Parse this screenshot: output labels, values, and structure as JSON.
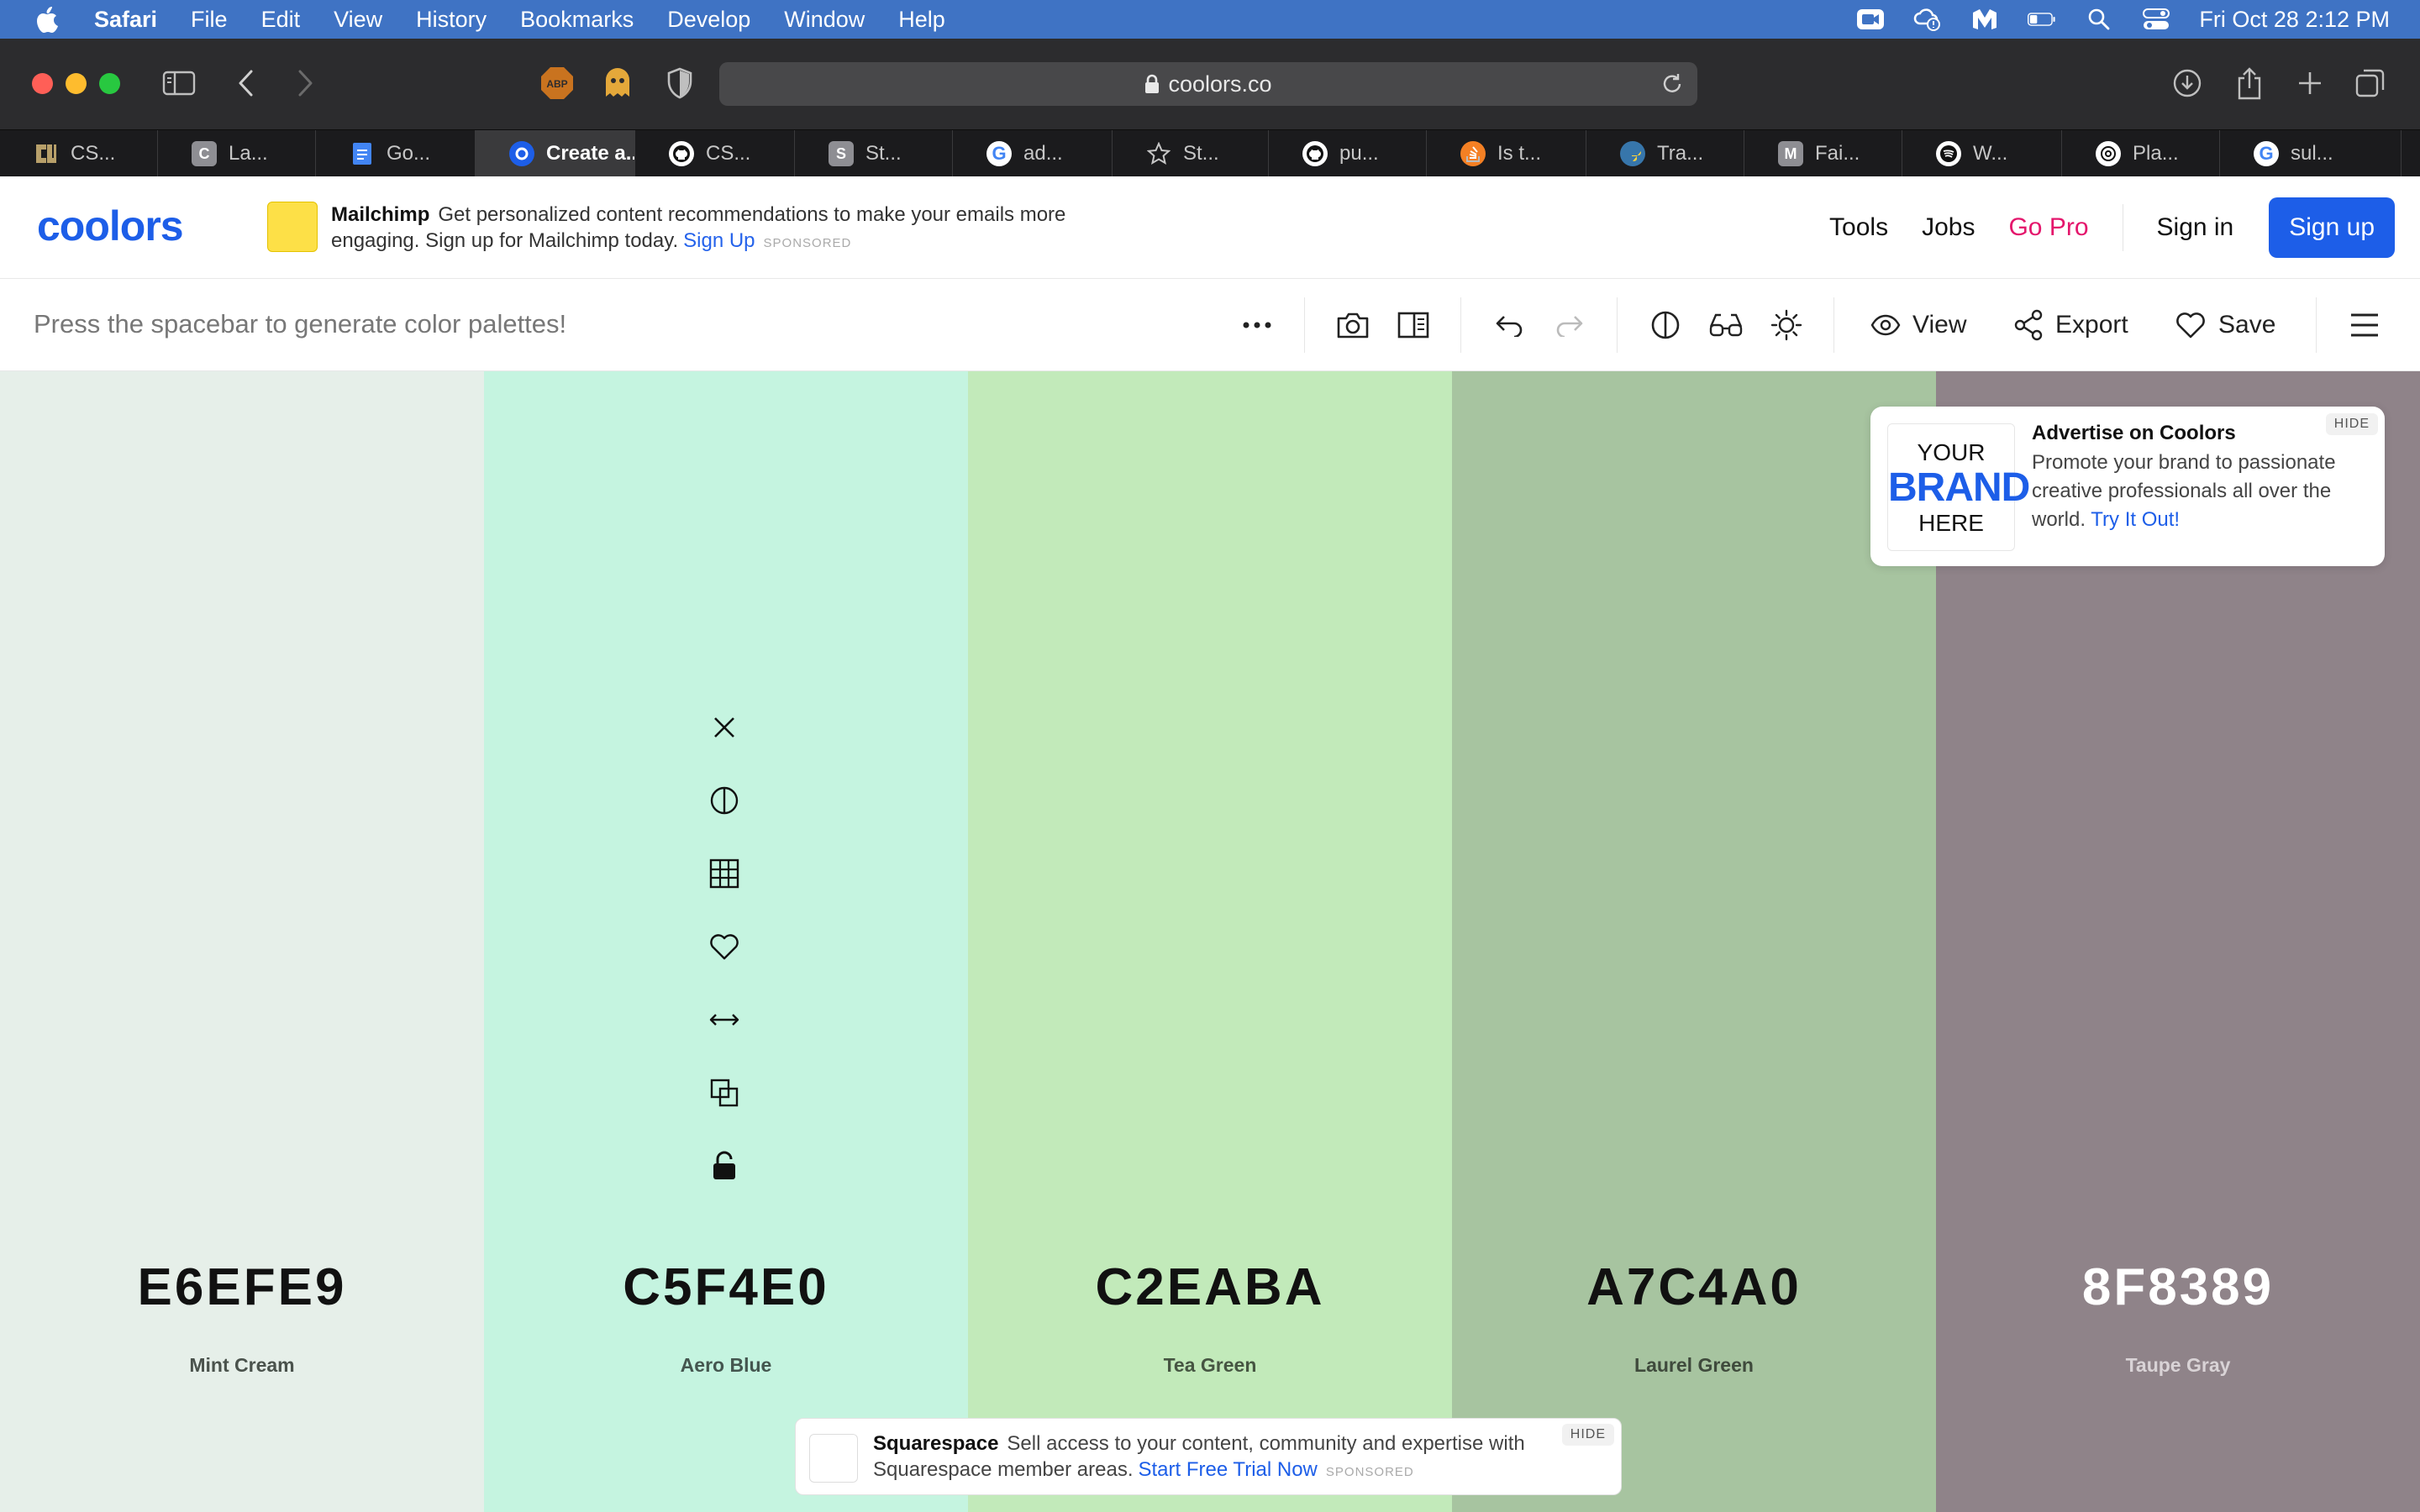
{
  "menubar": {
    "app_name": "Safari",
    "items": [
      "File",
      "Edit",
      "View",
      "History",
      "Bookmarks",
      "Develop",
      "Window",
      "Help"
    ],
    "clock": "Fri Oct 28  2:12 PM"
  },
  "browser": {
    "url": "coolors.co",
    "tabs": [
      {
        "label": "CS...",
        "favicon": "cu-icon",
        "color": "#b8a06a"
      },
      {
        "label": "La...",
        "favicon": "C",
        "color": "#8e8e93"
      },
      {
        "label": "Go...",
        "favicon": "docs-icon",
        "color": "#4285f4"
      },
      {
        "label": "Create a...",
        "favicon": "coolors-icon",
        "color": "#1d5ee8"
      },
      {
        "label": "CS...",
        "favicon": "github-icon",
        "color": "#ffffff"
      },
      {
        "label": "St...",
        "favicon": "S",
        "color": "#8e8e93"
      },
      {
        "label": "ad...",
        "favicon": "google-icon",
        "color": "#ffffff"
      },
      {
        "label": "St...",
        "favicon": "star-icon",
        "color": "#c7c7c7"
      },
      {
        "label": "pu...",
        "favicon": "github-icon",
        "color": "#ffffff"
      },
      {
        "label": "Is t...",
        "favicon": "stackoverflow-icon",
        "color": "#f48024"
      },
      {
        "label": "Tra...",
        "favicon": "python-icon",
        "color": "#3776ab"
      },
      {
        "label": "Fai...",
        "favicon": "M",
        "color": "#8e8e93"
      },
      {
        "label": "W...",
        "favicon": "spotify-icon",
        "color": "#ffffff"
      },
      {
        "label": "Pla...",
        "favicon": "openai-icon",
        "color": "#ffffff"
      },
      {
        "label": "sul...",
        "favicon": "google-icon",
        "color": "#ffffff"
      }
    ]
  },
  "header": {
    "logo_text": "coolors",
    "sponsor": {
      "name": "Mailchimp",
      "text": "Get personalized content recommendations to make your emails more engaging. Sign up for Mailchimp today.",
      "link": "Sign Up",
      "tag": "SPONSORED"
    },
    "nav": {
      "tools": "Tools",
      "jobs": "Jobs",
      "go_pro": "Go Pro",
      "sign_in": "Sign in",
      "sign_up": "Sign up"
    }
  },
  "toolbar": {
    "hint": "Press the spacebar to generate color palettes!",
    "view": "View",
    "export": "Export",
    "save": "Save"
  },
  "palette": [
    {
      "hex": "E6EFE9",
      "name": "Mint Cream",
      "bg": "#E6EFE9",
      "text_color": "#111111",
      "name_color": "#4a524c"
    },
    {
      "hex": "C5F4E0",
      "name": "Aero Blue",
      "bg": "#C5F4E0",
      "text_color": "#111111",
      "name_color": "#44564f"
    },
    {
      "hex": "C2EABA",
      "name": "Tea Green",
      "bg": "#C2EABA",
      "text_color": "#111111",
      "name_color": "#465542"
    },
    {
      "hex": "A7C4A0",
      "name": "Laurel Green",
      "bg": "#A7C4A0",
      "text_color": "#111111",
      "name_color": "#3f4a3c"
    },
    {
      "hex": "8F8389",
      "name": "Taupe Gray",
      "bg": "#8F8389",
      "text_color": "#ffffff",
      "name_color": "#d9d3d6"
    }
  ],
  "ad_top": {
    "brand_line1": "YOUR",
    "brand_line2": "BRAND",
    "brand_line3": "HERE",
    "title": "Advertise on Coolors",
    "body": "Promote your brand to passionate creative professionals all over the world.",
    "link": "Try It Out!",
    "hide": "HIDE"
  },
  "ad_bottom": {
    "name": "Squarespace",
    "text": "Sell access to your content, community and expertise with Squarespace member areas.",
    "link": "Start Free Trial Now",
    "tag": "SPONSORED",
    "hide": "HIDE"
  }
}
